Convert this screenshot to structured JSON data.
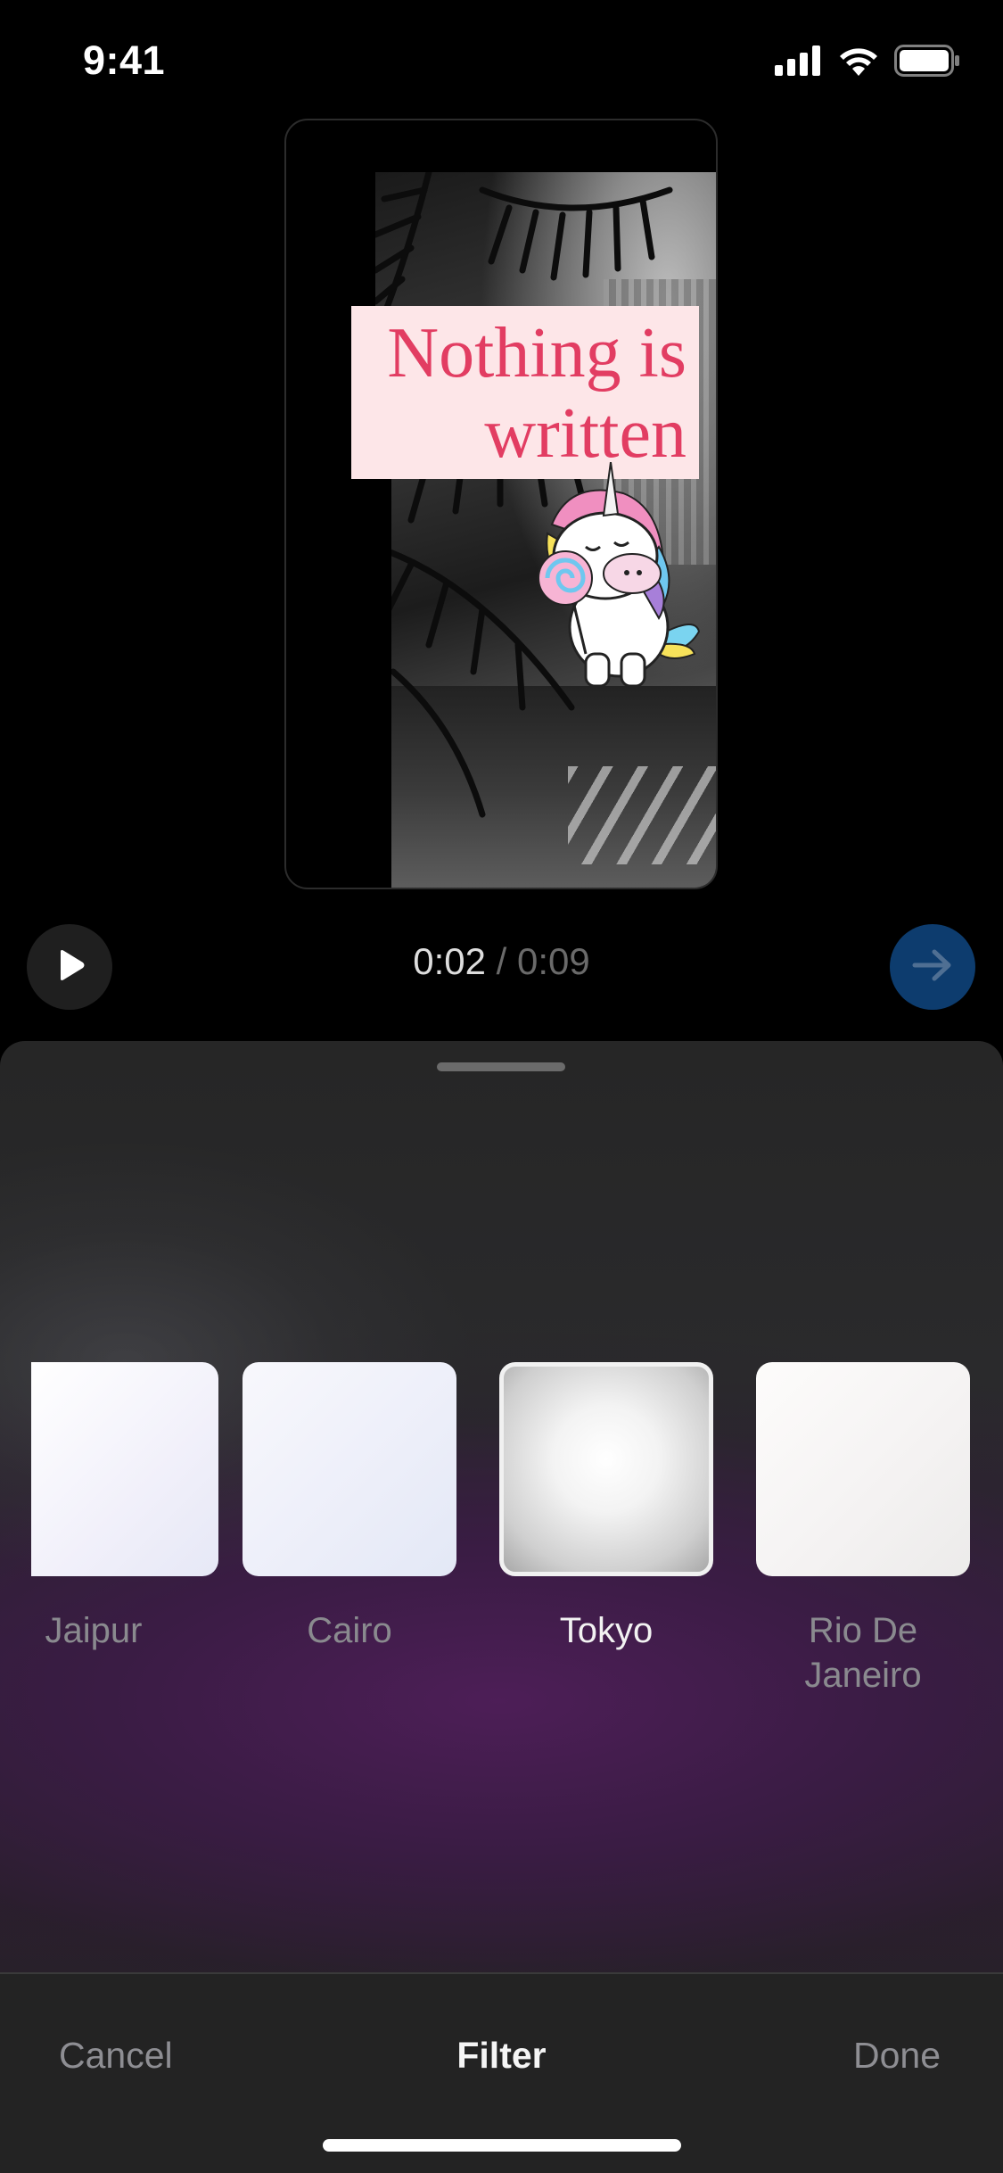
{
  "status_bar": {
    "time": "9:41",
    "icons": [
      "cellular-signal-icon",
      "wifi-icon",
      "battery-icon"
    ]
  },
  "preview": {
    "text_sticker": {
      "line1": "Nothing is",
      "line2": "written",
      "text_color": "#e23d62",
      "background_color": "#fde6e8"
    },
    "sticker": "unicorn-sticker"
  },
  "playback": {
    "current": "0:02",
    "separator": " / ",
    "total": "0:09",
    "play_icon": "play-icon",
    "next_icon": "arrow-right-icon",
    "accent_color": "#0d3c6e"
  },
  "filters": {
    "items": [
      {
        "label": "Jaipur",
        "selected": false
      },
      {
        "label": "Cairo",
        "selected": false
      },
      {
        "label": "Tokyo",
        "selected": true
      },
      {
        "label": "Rio De Janeiro",
        "selected": false
      }
    ]
  },
  "toolbar": {
    "cancel_label": "Cancel",
    "title": "Filter",
    "done_label": "Done"
  }
}
